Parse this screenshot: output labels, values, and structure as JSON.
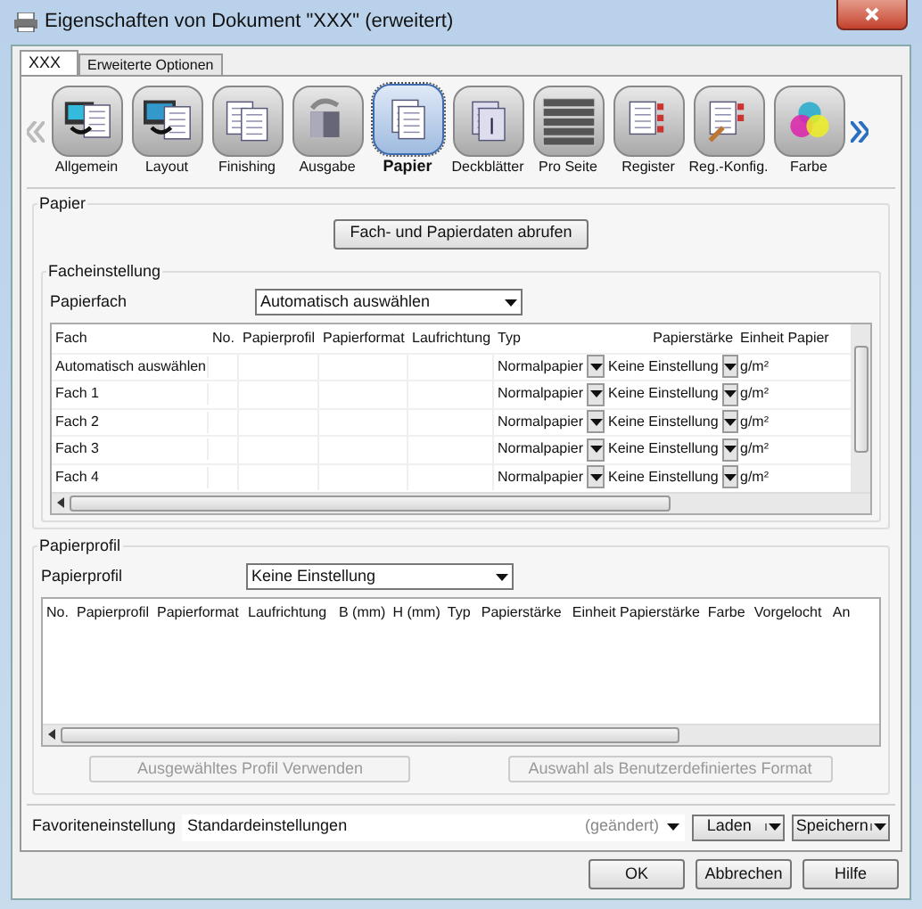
{
  "window": {
    "title": "Eigenschaften von Dokument \"XXX\" (erweitert)"
  },
  "tabs": [
    {
      "label": "XXX",
      "selected": true
    },
    {
      "label": "Erweiterte Optionen",
      "selected": false
    }
  ],
  "categories": [
    {
      "label": "Allgemein",
      "selected": false
    },
    {
      "label": "Layout",
      "selected": false
    },
    {
      "label": "Finishing",
      "selected": false
    },
    {
      "label": "Ausgabe",
      "selected": false
    },
    {
      "label": "Papier",
      "selected": true
    },
    {
      "label": "Deckblätter",
      "selected": false
    },
    {
      "label": "Pro Seite",
      "selected": false
    },
    {
      "label": "Register",
      "selected": false
    },
    {
      "label": "Reg.-Konfig.",
      "selected": false
    },
    {
      "label": "Farbe",
      "selected": false
    }
  ],
  "papier_group": {
    "title": "Papier",
    "fetch_button": "Fach- und Papierdaten abrufen"
  },
  "fach_group": {
    "title": "Facheinstellung",
    "papierfach_label": "Papierfach",
    "papierfach_value": "Automatisch auswählen",
    "columns": [
      "Fach",
      "No.",
      "Papierprofil",
      "Papierformat",
      "Laufrichtung",
      "Typ",
      "Papierstärke",
      "Einheit Papier"
    ],
    "rows": [
      {
        "fach": "Automatisch auswählen",
        "typ": "Normalpapier",
        "staerke": "Keine Einstellung",
        "einheit": "g/m²"
      },
      {
        "fach": "Fach 1",
        "typ": "Normalpapier",
        "staerke": "Keine Einstellung",
        "einheit": "g/m²"
      },
      {
        "fach": "Fach 2",
        "typ": "Normalpapier",
        "staerke": "Keine Einstellung",
        "einheit": "g/m²"
      },
      {
        "fach": "Fach 3",
        "typ": "Normalpapier",
        "staerke": "Keine Einstellung",
        "einheit": "g/m²"
      },
      {
        "fach": "Fach 4",
        "typ": "Normalpapier",
        "staerke": "Keine Einstellung",
        "einheit": "g/m²"
      }
    ]
  },
  "profil_group": {
    "title": "Papierprofil",
    "profil_label": "Papierprofil",
    "profil_value": "Keine Einstellung",
    "columns": [
      "No.",
      "Papierprofil",
      "Papierformat",
      "Laufrichtung",
      "B (mm)",
      "H (mm)",
      "Typ",
      "Papierstärke",
      "Einheit Papierstärke",
      "Farbe",
      "Vorgelocht",
      "An"
    ],
    "buttons": [
      {
        "label": "Ausgewähltes Profil Verwenden",
        "disabled": true
      },
      {
        "label": "Auswahl als Benutzerdefiniertes Format",
        "disabled": true
      }
    ]
  },
  "favorites": {
    "label": "Favoriteneinstellung",
    "value": "Standardeinstellungen",
    "note": "(geändert)",
    "load": "Laden",
    "save": "Speichern"
  },
  "footer_buttons": [
    "OK",
    "Abbrechen",
    "Hilfe"
  ]
}
